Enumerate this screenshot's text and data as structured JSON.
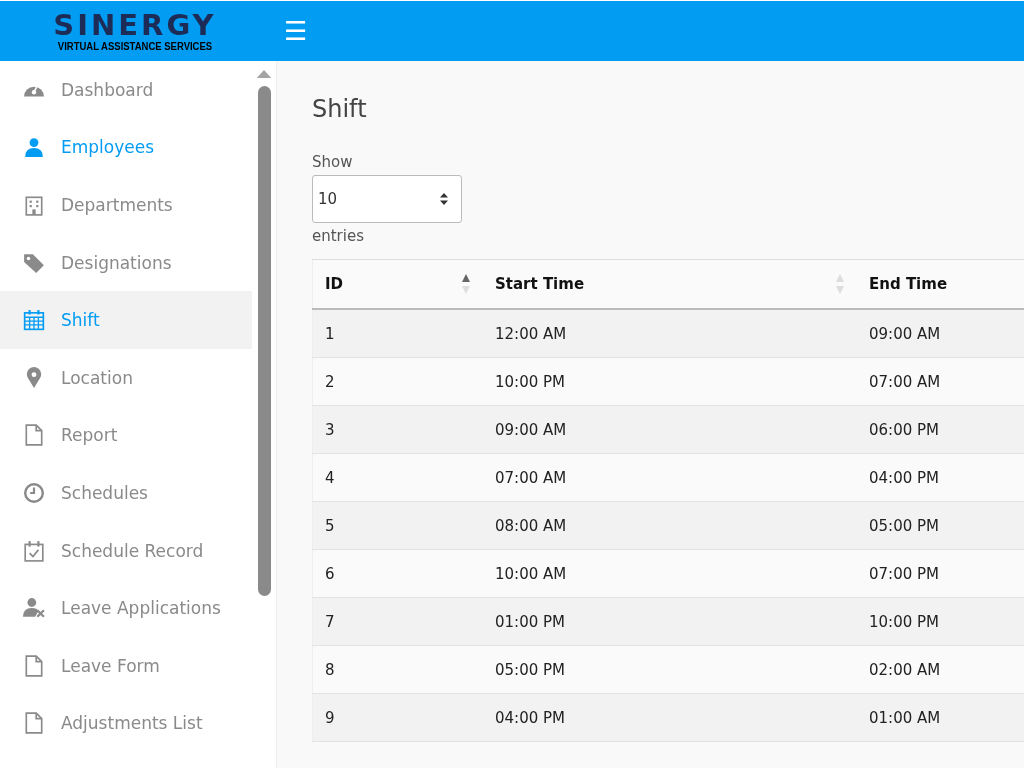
{
  "header": {
    "logo_title": "SINERGY",
    "logo_subtitle": "VIRTUAL ASSISTANCE SERVICES",
    "menu_glyph": "☰"
  },
  "sidebar": {
    "items": [
      {
        "label": "Dashboard",
        "active": false,
        "selected": false
      },
      {
        "label": "Employees",
        "active": true,
        "selected": false
      },
      {
        "label": "Departments",
        "active": false,
        "selected": false
      },
      {
        "label": "Designations",
        "active": false,
        "selected": false
      },
      {
        "label": "Shift",
        "active": true,
        "selected": true
      },
      {
        "label": "Location",
        "active": false,
        "selected": false
      },
      {
        "label": "Report",
        "active": false,
        "selected": false
      },
      {
        "label": "Schedules",
        "active": false,
        "selected": false
      },
      {
        "label": "Schedule Record",
        "active": false,
        "selected": false
      },
      {
        "label": "Leave Applications",
        "active": false,
        "selected": false
      },
      {
        "label": "Leave Form",
        "active": false,
        "selected": false
      },
      {
        "label": "Adjustments List",
        "active": false,
        "selected": false
      }
    ]
  },
  "page": {
    "title": "Shift",
    "show_label": "Show",
    "page_size": "10",
    "entries_label": "entries"
  },
  "table": {
    "columns": [
      {
        "label": "ID",
        "sortable": true,
        "sorted": true
      },
      {
        "label": "Start Time",
        "sortable": true,
        "sorted": false
      },
      {
        "label": "End Time"
      }
    ],
    "rows": [
      [
        "1",
        "12:00 AM",
        "09:00 AM"
      ],
      [
        "2",
        "10:00 PM",
        "07:00 AM"
      ],
      [
        "3",
        "09:00 AM",
        "06:00 PM"
      ],
      [
        "4",
        "07:00 AM",
        "04:00 PM"
      ],
      [
        "5",
        "08:00 AM",
        "05:00 PM"
      ],
      [
        "6",
        "10:00 AM",
        "07:00 PM"
      ],
      [
        "7",
        "01:00 PM",
        "10:00 PM"
      ],
      [
        "8",
        "05:00 PM",
        "02:00 AM"
      ],
      [
        "9",
        "04:00 PM",
        "01:00 AM"
      ]
    ]
  }
}
